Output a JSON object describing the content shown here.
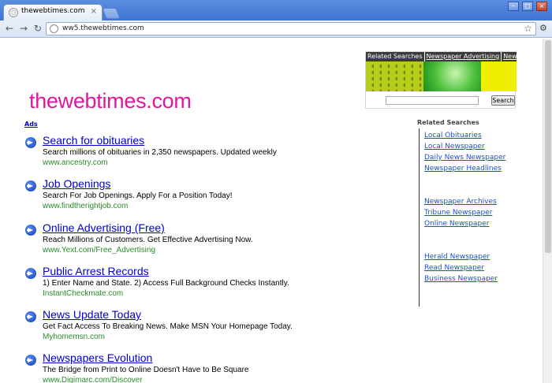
{
  "browser": {
    "tab_title": "thewebtimes.com",
    "tab_close": "×",
    "url": "ww5.thewebtimes.com",
    "window_controls": [
      "–",
      "□",
      "×"
    ],
    "icons": [
      "back-icon",
      "forward-icon",
      "reload-icon",
      "star-icon",
      "wrench-icon"
    ]
  },
  "page": {
    "logo": "thewebtimes.com",
    "related_box": {
      "links": [
        "Related Searches",
        "Newspaper Advertising",
        "Newspaper Paper"
      ],
      "search_button": "Search"
    },
    "ads_label": "Ads",
    "ads": [
      {
        "title": "Search for obituaries",
        "desc": "Search millions of obituaries in 2,350 newspapers. Updated weekly",
        "url": "www.ancestry.com"
      },
      {
        "title": "Job Openings",
        "desc": "Search For Job Openings. Apply For a Position Today!",
        "url": "www.findtherightjob.com"
      },
      {
        "title": "Online Advertising (Free)",
        "desc": "Reach Millions of Customers. Get Effective Advertising Now.",
        "url": "www.Yext.com/Free_Advertising"
      },
      {
        "title": "Public Arrest Records",
        "desc": "1) Enter Name and State. 2) Access Full Background Checks Instantly.",
        "url": "InstantCheckmate.com"
      },
      {
        "title": "News Update Today",
        "desc": "Get Fact Access To Breaking News. Make MSN Your Homepage Today.",
        "url": "Myhomemsn.com"
      },
      {
        "title": "Newspapers Evolution",
        "desc": "The Bridge from Print to Online Doesn't Have to Be Square",
        "url": "www.Digimarc.com/Discover"
      }
    ],
    "related_searches": {
      "heading": "Related Searches",
      "groups": [
        [
          "Local Obituaries",
          "Local Newspaper",
          "Daily News Newspaper",
          "Newspaper Headlines"
        ],
        [
          "Newspaper Archives",
          "Tribune Newspaper",
          "Online Newspaper"
        ],
        [
          "Herald Newspaper",
          "Read Newspaper",
          "Business Newspaper"
        ]
      ]
    }
  }
}
